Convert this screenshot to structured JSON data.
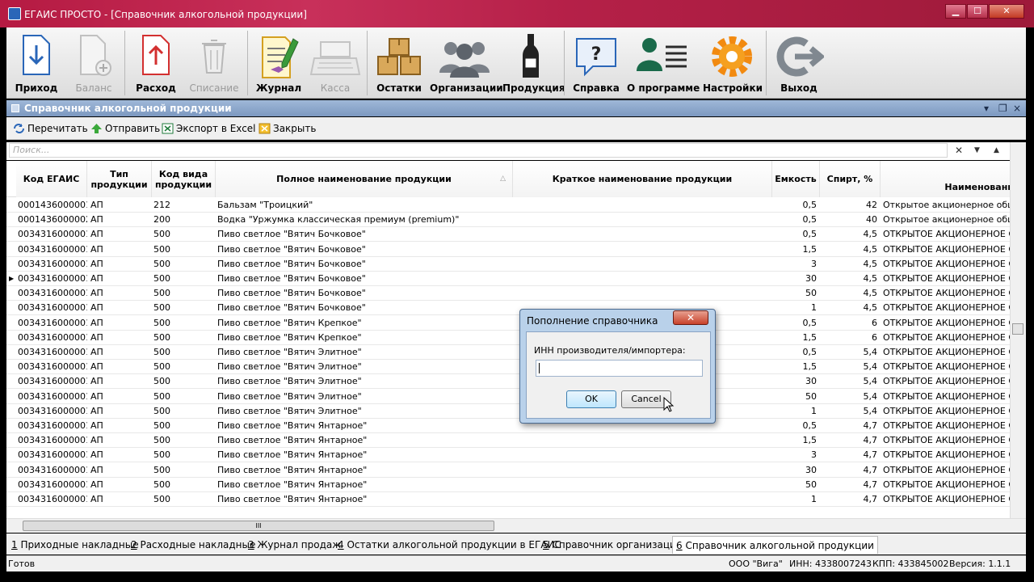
{
  "window": {
    "title": "ЕГАИС ПРОСТО - [Справочник алкогольной продукции]"
  },
  "ribbon": {
    "prihod": "Приход",
    "balans": "Баланс",
    "rashod": "Расход",
    "spisanie": "Списание",
    "zhurnal": "Журнал",
    "kassa": "Касса",
    "ostatki": "Остатки",
    "organizacii": "Организации",
    "produkciya": "Продукция",
    "spravka": "Справка",
    "o_programme": "О программе",
    "nastroyki": "Настройки",
    "vyhod": "Выход"
  },
  "document": {
    "title": "Справочник алкогольной продукции"
  },
  "toolbar": {
    "reread": "Перечитать",
    "send": "Отправить",
    "export": "Экспорт в Excel",
    "close": "Закрыть"
  },
  "search": {
    "placeholder": "Поиск..."
  },
  "table": {
    "headers": [
      "Код ЕГАИС",
      "Тип продукции",
      "Код вида продукции",
      "Полное наименование продукции",
      "Краткое наименование продукции",
      "Емкость",
      "Спирт, %",
      "Наименовани"
    ],
    "rows": [
      [
        "00014360000011",
        "АП",
        "212",
        "Бальзам \"Троицкий\"",
        "",
        "0,5",
        "42",
        "Открытое акционерное общес"
      ],
      [
        "00014360000023",
        "АП",
        "200",
        "Водка \"Уржумка классическая премиум (premium)\"",
        "",
        "0,5",
        "40",
        "Открытое акционерное общес"
      ],
      [
        "00343160000012",
        "АП",
        "500",
        "Пиво светлое \"Вятич Бочковое\"",
        "",
        "0,5",
        "4,5",
        "ОТКРЫТОЕ АКЦИОНЕРНОЕ ОБЩ"
      ],
      [
        "00343160000012",
        "АП",
        "500",
        "Пиво светлое \"Вятич Бочковое\"",
        "",
        "1,5",
        "4,5",
        "ОТКРЫТОЕ АКЦИОНЕРНОЕ ОБЩ"
      ],
      [
        "00343160000012",
        "АП",
        "500",
        "Пиво светлое \"Вятич Бочковое\"",
        "",
        "3",
        "4,5",
        "ОТКРЫТОЕ АКЦИОНЕРНОЕ ОБЩ"
      ],
      [
        "00343160000012",
        "АП",
        "500",
        "Пиво светлое \"Вятич Бочковое\"",
        "",
        "30",
        "4,5",
        "ОТКРЫТОЕ АКЦИОНЕРНОЕ ОБЩ"
      ],
      [
        "00343160000012",
        "АП",
        "500",
        "Пиво светлое \"Вятич Бочковое\"",
        "",
        "50",
        "4,5",
        "ОТКРЫТОЕ АКЦИОНЕРНОЕ ОБЩ"
      ],
      [
        "00343160000012",
        "АП",
        "500",
        "Пиво светлое \"Вятич Бочковое\"",
        "",
        "1",
        "4,5",
        "ОТКРЫТОЕ АКЦИОНЕРНОЕ ОБЩ"
      ],
      [
        "00343160000012",
        "АП",
        "500",
        "Пиво светлое \"Вятич Крепкое\"",
        "",
        "0,5",
        "6",
        "ОТКРЫТОЕ АКЦИОНЕРНОЕ ОБЩ"
      ],
      [
        "00343160000012",
        "АП",
        "500",
        "Пиво светлое \"Вятич Крепкое\"",
        "",
        "1,5",
        "6",
        "ОТКРЫТОЕ АКЦИОНЕРНОЕ ОБЩ"
      ],
      [
        "00343160000012",
        "АП",
        "500",
        "Пиво светлое \"Вятич Элитное\"",
        "",
        "0,5",
        "5,4",
        "ОТКРЫТОЕ АКЦИОНЕРНОЕ ОБЩ"
      ],
      [
        "00343160000012",
        "АП",
        "500",
        "Пиво светлое \"Вятич Элитное\"",
        "",
        "1,5",
        "5,4",
        "ОТКРЫТОЕ АКЦИОНЕРНОЕ ОБЩ"
      ],
      [
        "00343160000012",
        "АП",
        "500",
        "Пиво светлое \"Вятич Элитное\"",
        "",
        "30",
        "5,4",
        "ОТКРЫТОЕ АКЦИОНЕРНОЕ ОБЩ"
      ],
      [
        "00343160000012",
        "АП",
        "500",
        "Пиво светлое \"Вятич Элитное\"",
        "",
        "50",
        "5,4",
        "ОТКРЫТОЕ АКЦИОНЕРНОЕ ОБЩ"
      ],
      [
        "00343160000012",
        "АП",
        "500",
        "Пиво светлое \"Вятич Элитное\"",
        "",
        "1",
        "5,4",
        "ОТКРЫТОЕ АКЦИОНЕРНОЕ ОБЩ"
      ],
      [
        "00343160000012",
        "АП",
        "500",
        "Пиво светлое \"Вятич Янтарное\"",
        "",
        "0,5",
        "4,7",
        "ОТКРЫТОЕ АКЦИОНЕРНОЕ ОБЩ"
      ],
      [
        "00343160000012",
        "АП",
        "500",
        "Пиво светлое \"Вятич Янтарное\"",
        "",
        "1,5",
        "4,7",
        "ОТКРЫТОЕ АКЦИОНЕРНОЕ ОБЩ"
      ],
      [
        "00343160000012",
        "АП",
        "500",
        "Пиво светлое \"Вятич Янтарное\"",
        "",
        "3",
        "4,7",
        "ОТКРЫТОЕ АКЦИОНЕРНОЕ ОБЩ"
      ],
      [
        "00343160000012",
        "АП",
        "500",
        "Пиво светлое \"Вятич Янтарное\"",
        "",
        "30",
        "4,7",
        "ОТКРЫТОЕ АКЦИОНЕРНОЕ ОБЩ"
      ],
      [
        "00343160000012",
        "АП",
        "500",
        "Пиво светлое \"Вятич Янтарное\"",
        "",
        "50",
        "4,7",
        "ОТКРЫТОЕ АКЦИОНЕРНОЕ ОБЩ"
      ],
      [
        "00343160000012",
        "АП",
        "500",
        "Пиво светлое \"Вятич Янтарное\"",
        "",
        "1",
        "4,7",
        "ОТКРЫТОЕ АКЦИОНЕРНОЕ ОБЩ"
      ]
    ]
  },
  "tabs": [
    {
      "num": "1",
      "label": "Приходные накладные"
    },
    {
      "num": "2",
      "label": "Расходные накладные"
    },
    {
      "num": "3",
      "label": "Журнал продаж"
    },
    {
      "num": "4",
      "label": "Остатки алкогольной продукции в ЕГАИС"
    },
    {
      "num": "5",
      "label": "Справочник организаций"
    },
    {
      "num": "6",
      "label": "Справочник алкогольной продукции"
    }
  ],
  "status": {
    "ready": "Готов",
    "org": "ООО \"Вига\"",
    "inn": "ИНН: 4338007243",
    "kpp": "КПП: 433845002",
    "version": "Версия: 1.1.1"
  },
  "dialog": {
    "title": "Пополнение справочника",
    "label": "ИНН производителя/импортера:",
    "ok": "OK",
    "cancel": "Cancel",
    "close_glyph": "✕"
  },
  "glyphs": {
    "clear": "✕",
    "down": "▼",
    "up": "▲",
    "sort": "△",
    "min": "▁",
    "max": "☐",
    "close": "✕",
    "scroll_grip": "III",
    "doc_close": "×",
    "doc_restore": "❐",
    "doc_pin": "▾"
  },
  "colors": {
    "titlebar": "#b51a42",
    "accent": "#2a66b8"
  }
}
